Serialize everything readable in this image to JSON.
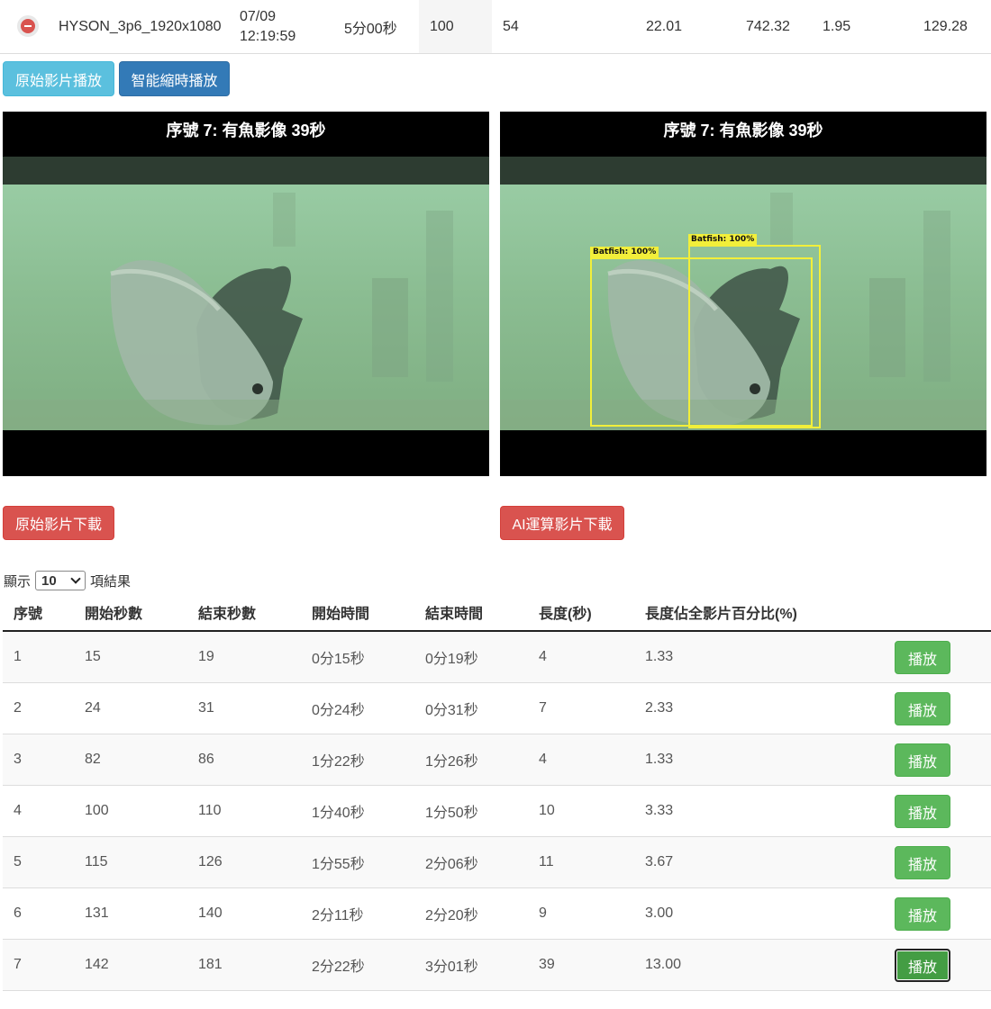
{
  "summary": {
    "filename": "HYSON_3p6_1920x1080",
    "date": "07/09",
    "time": "12:19:59",
    "duration": "5分00秒",
    "col_a": "100",
    "col_b": "54",
    "col_c": "22.01",
    "col_d": "742.32",
    "col_e": "1.95",
    "col_f": "129.28"
  },
  "mode_buttons": {
    "original_play": "原始影片播放",
    "smart_play": "智能縮時播放"
  },
  "videos": {
    "left_caption": "序號 7: 有魚影像 39秒",
    "right_caption": "序號 7: 有魚影像 39秒",
    "detections": [
      {
        "label": "Batfish: 100%"
      },
      {
        "label": "Batfish: 100%"
      }
    ]
  },
  "downloads": {
    "original": "原始影片下載",
    "ai": "AI運算影片下載"
  },
  "page_length": {
    "prefix": "顯示",
    "value": "10",
    "suffix": "項結果"
  },
  "table": {
    "headers": [
      "序號",
      "開始秒數",
      "結束秒數",
      "開始時間",
      "結束時間",
      "長度(秒)",
      "長度佔全影片百分比(%)"
    ],
    "play_label": "播放",
    "rows": [
      {
        "no": "1",
        "start_sec": "15",
        "end_sec": "19",
        "start_time": "0分15秒",
        "end_time": "0分19秒",
        "length": "4",
        "percent": "1.33"
      },
      {
        "no": "2",
        "start_sec": "24",
        "end_sec": "31",
        "start_time": "0分24秒",
        "end_time": "0分31秒",
        "length": "7",
        "percent": "2.33"
      },
      {
        "no": "3",
        "start_sec": "82",
        "end_sec": "86",
        "start_time": "1分22秒",
        "end_time": "1分26秒",
        "length": "4",
        "percent": "1.33"
      },
      {
        "no": "4",
        "start_sec": "100",
        "end_sec": "110",
        "start_time": "1分40秒",
        "end_time": "1分50秒",
        "length": "10",
        "percent": "3.33"
      },
      {
        "no": "5",
        "start_sec": "115",
        "end_sec": "126",
        "start_time": "1分55秒",
        "end_time": "2分06秒",
        "length": "11",
        "percent": "3.67"
      },
      {
        "no": "6",
        "start_sec": "131",
        "end_sec": "140",
        "start_time": "2分11秒",
        "end_time": "2分20秒",
        "length": "9",
        "percent": "3.00"
      },
      {
        "no": "7",
        "start_sec": "142",
        "end_sec": "181",
        "start_time": "2分22秒",
        "end_time": "3分01秒",
        "length": "39",
        "percent": "13.00"
      }
    ],
    "active_row": "7"
  },
  "colors": {
    "info": "#5bc0de",
    "primary": "#337ab7",
    "danger": "#d9534f",
    "success": "#5cb85c",
    "detection_box": "#f2ef3a"
  }
}
